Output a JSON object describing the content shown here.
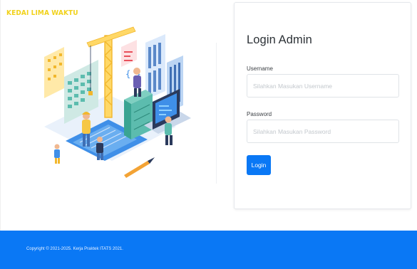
{
  "brand": {
    "name": "KEDAI LIMA WAKTU"
  },
  "login": {
    "title": "Login Admin",
    "username_label": "Username",
    "username_placeholder": "Silahkan Masukan Username",
    "password_label": "Password",
    "password_placeholder": "Silahkan Masukan Password",
    "button_label": "Login"
  },
  "footer": {
    "copyright": "Copyright © 2021-2025. Kerja Praktek ITATS 2021."
  },
  "colors": {
    "brand": "#f1d21c",
    "primary": "#0a78f5"
  },
  "illustration": {
    "subject": "construction-team-building-website-illustration"
  }
}
